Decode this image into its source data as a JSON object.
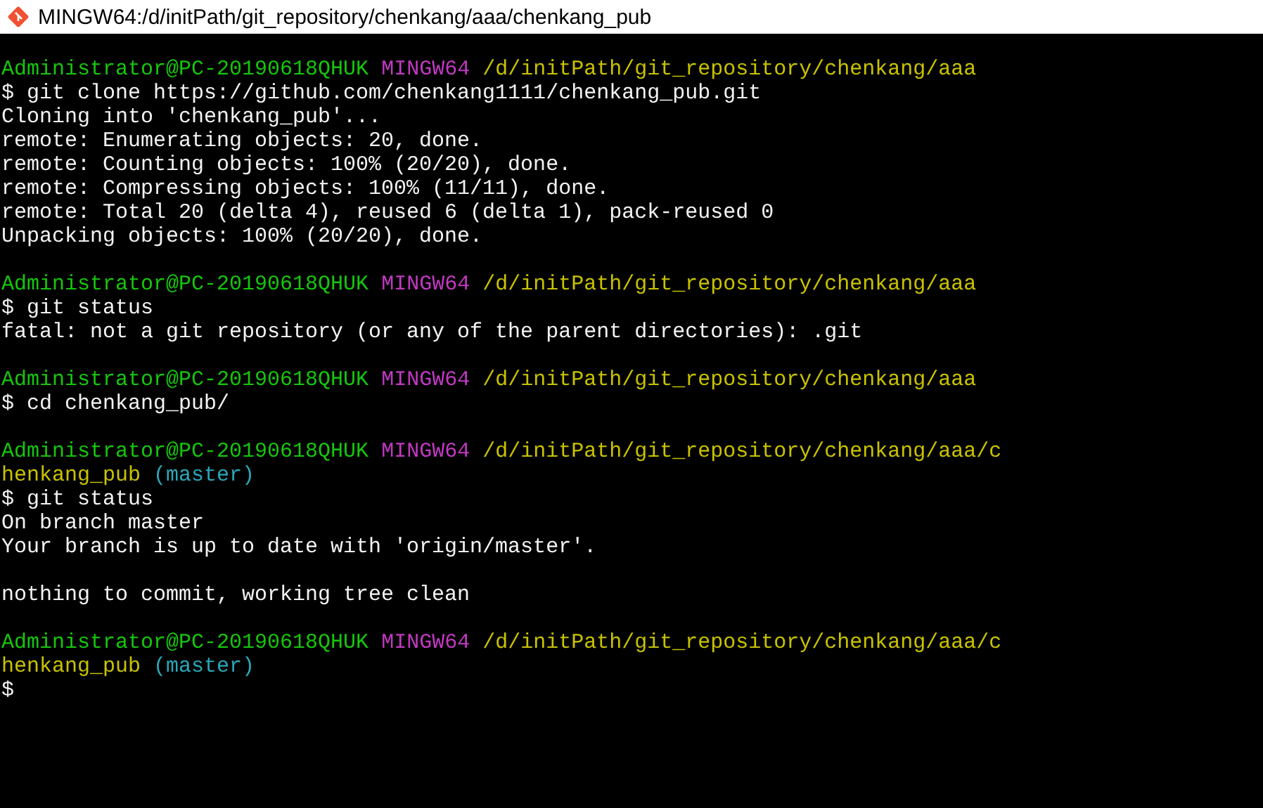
{
  "window": {
    "title": "MINGW64:/d/initPath/git_repository/chenkang/aaa/chenkang_pub"
  },
  "lines": [
    {
      "kind": "blank"
    },
    {
      "kind": "prompt",
      "user": "Administrator@PC-20190618QHUK",
      "system": "MINGW64",
      "path": "/d/initPath/git_repository/chenkang/aaa"
    },
    {
      "kind": "command",
      "text": "$ git clone https://github.com/chenkang1111/chenkang_pub.git"
    },
    {
      "kind": "output",
      "text": "Cloning into 'chenkang_pub'..."
    },
    {
      "kind": "output",
      "text": "remote: Enumerating objects: 20, done."
    },
    {
      "kind": "output",
      "text": "remote: Counting objects: 100% (20/20), done."
    },
    {
      "kind": "output",
      "text": "remote: Compressing objects: 100% (11/11), done."
    },
    {
      "kind": "output",
      "text": "remote: Total 20 (delta 4), reused 6 (delta 1), pack-reused 0"
    },
    {
      "kind": "output",
      "text": "Unpacking objects: 100% (20/20), done."
    },
    {
      "kind": "blank"
    },
    {
      "kind": "prompt",
      "user": "Administrator@PC-20190618QHUK",
      "system": "MINGW64",
      "path": "/d/initPath/git_repository/chenkang/aaa"
    },
    {
      "kind": "command",
      "text": "$ git status"
    },
    {
      "kind": "output",
      "text": "fatal: not a git repository (or any of the parent directories): .git"
    },
    {
      "kind": "blank"
    },
    {
      "kind": "prompt",
      "user": "Administrator@PC-20190618QHUK",
      "system": "MINGW64",
      "path": "/d/initPath/git_repository/chenkang/aaa"
    },
    {
      "kind": "command",
      "text": "$ cd chenkang_pub/"
    },
    {
      "kind": "blank"
    },
    {
      "kind": "prompt",
      "user": "Administrator@PC-20190618QHUK",
      "system": "MINGW64",
      "path": "/d/initPath/git_repository/chenkang/aaa/chenkang_pub",
      "branch": "(master)"
    },
    {
      "kind": "command",
      "text": "$ git status"
    },
    {
      "kind": "output",
      "text": "On branch master"
    },
    {
      "kind": "output",
      "text": "Your branch is up to date with 'origin/master'."
    },
    {
      "kind": "blank"
    },
    {
      "kind": "output",
      "text": "nothing to commit, working tree clean"
    },
    {
      "kind": "blank"
    },
    {
      "kind": "prompt",
      "user": "Administrator@PC-20190618QHUK",
      "system": "MINGW64",
      "path": "/d/initPath/git_repository/chenkang/aaa/chenkang_pub",
      "branch": "(master)"
    },
    {
      "kind": "command",
      "text": "$"
    }
  ]
}
